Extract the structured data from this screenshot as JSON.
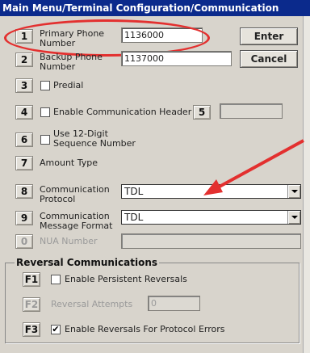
{
  "window": {
    "title": "Main Menu/Terminal Configuration/Communication"
  },
  "buttons": {
    "enter": "Enter",
    "cancel": "Cancel"
  },
  "rows": {
    "primary_phone": {
      "num": "1",
      "label": "Primary Phone Number",
      "value": "1136000"
    },
    "backup_phone": {
      "num": "2",
      "label": "Backup Phone Number",
      "value": "1137000"
    },
    "predial": {
      "num": "3",
      "label": "Predial",
      "checked": false
    },
    "comm_header": {
      "num": "4",
      "label": "Enable Communication Header",
      "checked": false,
      "extra_num": "5",
      "extra_value": ""
    },
    "seq_number": {
      "num": "6",
      "label": "Use 12-Digit Sequence Number",
      "checked": false
    },
    "amount_type": {
      "num": "7",
      "label": "Amount Type"
    },
    "comm_protocol": {
      "num": "8",
      "label": "Communication Protocol",
      "selected": "TDL"
    },
    "msg_format": {
      "num": "9",
      "label": "Communication Message Format",
      "selected": "TDL"
    },
    "nua_number": {
      "num": "0",
      "label": "NUA Number",
      "value": ""
    }
  },
  "reversal": {
    "title": "Reversal Communications",
    "persistent": {
      "num": "F1",
      "label": "Enable Persistent Reversals",
      "checked": false
    },
    "attempts": {
      "num": "F2",
      "label": "Reversal Attempts",
      "value": "0"
    },
    "protocol_errors": {
      "num": "F3",
      "label": "Enable Reversals For Protocol Errors",
      "checked": true,
      "mark": "✔"
    }
  },
  "annotation_colors": {
    "ellipse": "#e3302f",
    "arrow": "#e3302f"
  }
}
